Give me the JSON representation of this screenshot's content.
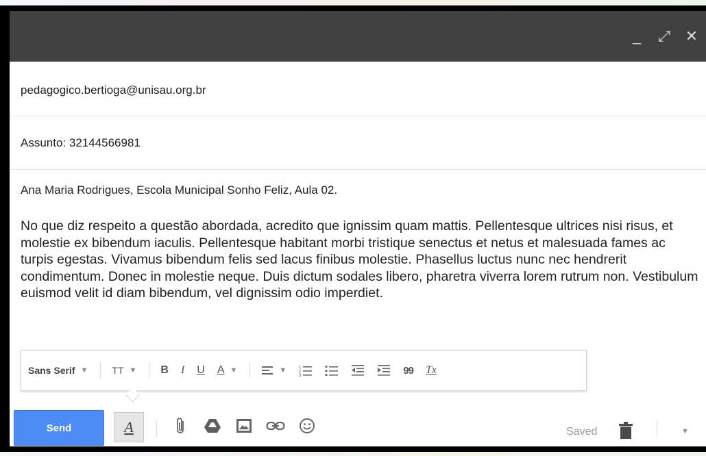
{
  "window": {
    "controls": [
      {
        "name": "minimize-icon",
        "glyph": "_"
      },
      {
        "name": "expand-icon",
        "glyph": "⤢"
      },
      {
        "name": "close-icon",
        "glyph": "✕"
      }
    ]
  },
  "compose": {
    "to": "pedagogico.bertioga@unisau.org.br",
    "subject": "Assunto: 32144566981",
    "greeting": "Ana Maria Rodrigues, Escola Municipal Sonho Feliz, Aula 02.",
    "body": "No que diz respeito a questão abordada, acredito que  ignissim quam mattis. Pellentesque ultrices nisi risus, et molestie ex bibendum iaculis. Pellentesque habitant morbi tristique senectus et netus et malesuada fames ac turpis egestas. Vivamus bibendum felis sed lacus finibus molestie. Phasellus luctus nunc nec hendrerit condimentum. Donec in molestie neque. Duis dictum sodales libero, pharetra viverra lorem rutrum non. Vestibulum euismod velit id diam bibendum, vel dignissim odio imperdiet."
  },
  "format_toolbar": {
    "font": "Sans Serif",
    "size_glyph": "TT",
    "bold": "B",
    "italic": "I",
    "underline": "U",
    "text_color": "A",
    "quote": "99",
    "clear": "Tx"
  },
  "bottom_bar": {
    "send_label": "Send",
    "format_toggle": "A",
    "status": "Saved"
  },
  "colors": {
    "titlebar": "#404040",
    "send_button": "#4d8bf5"
  }
}
